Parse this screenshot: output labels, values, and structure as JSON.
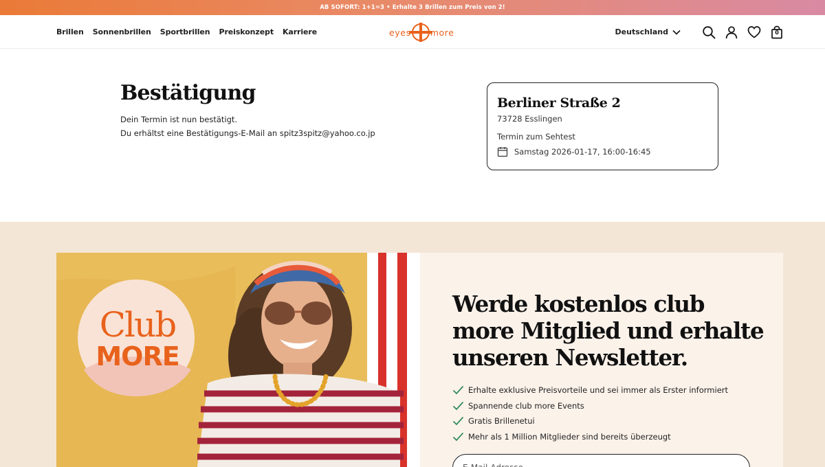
{
  "promo": {
    "text": "AB SOFORT: 1+1=3 • Erhalte 3 Brillen zum Preis von 2!"
  },
  "header": {
    "nav": [
      "Brillen",
      "Sonnenbrillen",
      "Sportbrillen",
      "Preiskonzept",
      "Karriere"
    ],
    "logo": {
      "left": "eyes",
      "right": "more"
    },
    "country": "Deutschland",
    "cart_count": "0"
  },
  "confirmation": {
    "title": "Bestätigung",
    "line1": "Dein Termin ist nun bestätigt.",
    "line2": "Du erhältst eine Bestätigungs-E-Mail an spitz3spitz@yahoo.co.jp"
  },
  "store": {
    "street": "Berliner Straße 2",
    "city": "73728 Esslingen",
    "appointment_type": "Termin zum Sehtest",
    "datetime": "Samstag 2026-01-17, 16:00-16:45"
  },
  "club": {
    "badge_line1": "Club",
    "badge_line2": "MORE"
  },
  "newsletter": {
    "title": "Werde kostenlos club more Mitglied und erhalte unseren Newsletter.",
    "benefits": [
      "Erhalte exklusive Preisvorteile und sei immer als Erster informiert",
      "Spannende club more Events",
      "Gratis Brillenetui",
      "Mehr als 1 Million Mitglieder sind bereits überzeugt"
    ],
    "email_placeholder": "E-Mail-Adresse"
  },
  "colors": {
    "brand_orange": "#e8621c",
    "check_green": "#2e8a57",
    "section_bg": "#f4e6d7"
  }
}
